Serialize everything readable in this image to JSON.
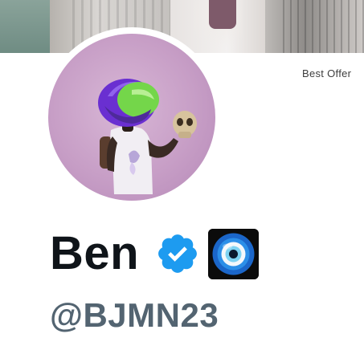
{
  "banner": {
    "caption": "Best Offer"
  },
  "profile": {
    "display_name": "Ben",
    "handle": "@BJMN23",
    "verified": true,
    "avatar_icon": "avatar-image",
    "verified_icon": "verified-badge-icon",
    "emoji_icon": "nazar-amulet-icon"
  },
  "colors": {
    "name_text": "#0f1419",
    "handle_text": "#536471",
    "verified_blue": "#1d9bf0",
    "avatar_bg": "#c79ec6"
  }
}
